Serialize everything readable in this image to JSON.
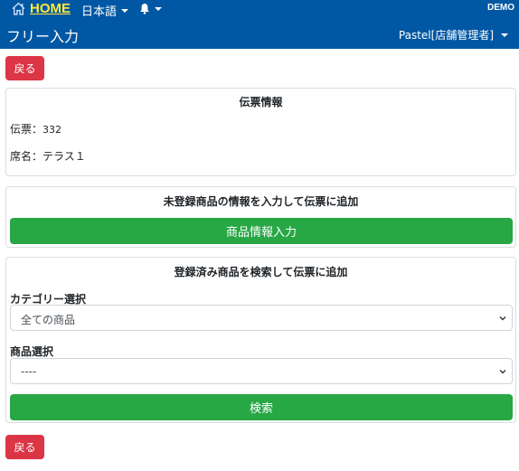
{
  "header": {
    "home_label": "HOME",
    "language_label": "日本語",
    "env_label": "DEMO",
    "page_title": "フリー入力",
    "user_label": "Pastel[店舗管理者]"
  },
  "back_label": "戻る",
  "slip_card": {
    "title": "伝票情報",
    "slip_label": "伝票：",
    "slip_value": "332",
    "seat_label": "席名：",
    "seat_value": "テラス１"
  },
  "unregistered_card": {
    "title": "未登録商品の情報を入力して伝票に追加",
    "button_label": "商品情報入力"
  },
  "registered_card": {
    "title": "登録済み商品を検索して伝票に追加",
    "category_label": "カテゴリー選択",
    "category_selected": "全ての商品",
    "product_label": "商品選択",
    "product_selected": "----",
    "search_label": "検索"
  },
  "colors": {
    "header_bg": "#0057a3",
    "home_text": "#ffeb3b",
    "danger": "#dc3545",
    "success": "#28a745"
  }
}
